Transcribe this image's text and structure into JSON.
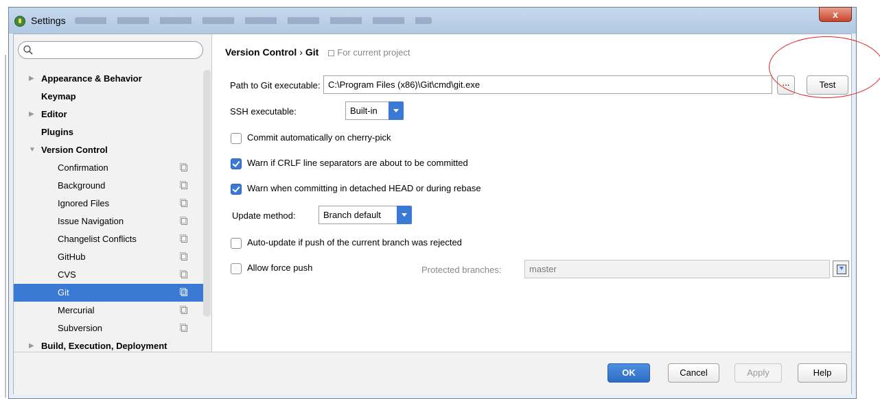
{
  "window": {
    "title": "Settings",
    "close_label": "x"
  },
  "sidebar": {
    "search_placeholder": "",
    "items": [
      {
        "label": "Appearance & Behavior",
        "level": "top",
        "expandable": true,
        "expanded": false
      },
      {
        "label": "Keymap",
        "level": "top",
        "expandable": false
      },
      {
        "label": "Editor",
        "level": "top",
        "expandable": true,
        "expanded": false
      },
      {
        "label": "Plugins",
        "level": "top",
        "expandable": false
      },
      {
        "label": "Version Control",
        "level": "top",
        "expandable": true,
        "expanded": true
      },
      {
        "label": "Confirmation",
        "level": "sub"
      },
      {
        "label": "Background",
        "level": "sub"
      },
      {
        "label": "Ignored Files",
        "level": "sub"
      },
      {
        "label": "Issue Navigation",
        "level": "sub"
      },
      {
        "label": "Changelist Conflicts",
        "level": "sub"
      },
      {
        "label": "GitHub",
        "level": "sub"
      },
      {
        "label": "CVS",
        "level": "sub"
      },
      {
        "label": "Git",
        "level": "sub",
        "selected": true
      },
      {
        "label": "Mercurial",
        "level": "sub"
      },
      {
        "label": "Subversion",
        "level": "sub"
      },
      {
        "label": "Build, Execution, Deployment",
        "level": "top",
        "expandable": true,
        "expanded": false
      }
    ]
  },
  "breadcrumb": {
    "parent": "Version Control",
    "separator": "›",
    "current": "Git",
    "hint": "For current project"
  },
  "form": {
    "path_label": "Path to Git executable:",
    "path_value": "C:\\Program Files (x86)\\Git\\cmd\\git.exe",
    "browse_label": "...",
    "test_label": "Test",
    "ssh_label": "SSH executable:",
    "ssh_value": "Built-in",
    "cherry_pick_label": "Commit automatically on cherry-pick",
    "cherry_pick_checked": false,
    "crlf_label": "Warn if CRLF line separators are about to be committed",
    "crlf_checked": true,
    "detached_label": "Warn when committing in detached HEAD or during rebase",
    "detached_checked": true,
    "update_method_label": "Update method:",
    "update_method_value": "Branch default",
    "auto_update_label": "Auto-update if push of the current branch was rejected",
    "auto_update_checked": false,
    "force_push_label": "Allow force push",
    "force_push_checked": false,
    "protected_label": "Protected branches:",
    "protected_value": "master"
  },
  "footer": {
    "ok": "OK",
    "cancel": "Cancel",
    "apply": "Apply",
    "help": "Help"
  },
  "colors": {
    "accent": "#3a79d4",
    "annotation": "#e02020"
  }
}
